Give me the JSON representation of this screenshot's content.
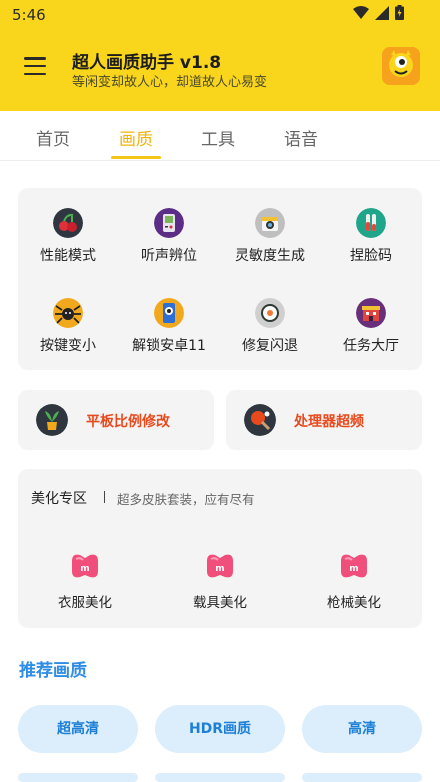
{
  "status": {
    "time": "5:46"
  },
  "header": {
    "title": "超人画质助手 v1.8",
    "subtitle": "等闲变却故人心，却道故人心易变",
    "accent_color": "#f9d51c"
  },
  "tabs": [
    {
      "label": "首页"
    },
    {
      "label": "画质"
    },
    {
      "label": "工具"
    },
    {
      "label": "语音"
    }
  ],
  "active_tab": "画质",
  "feature_grid": [
    {
      "label": "性能模式",
      "icon": "cherries-icon"
    },
    {
      "label": "听声辨位",
      "icon": "gameboy-icon"
    },
    {
      "label": "灵敏度生成",
      "icon": "camera-icon"
    },
    {
      "label": "捏脸码",
      "icon": "test-tube-icon"
    },
    {
      "label": "按键变小",
      "icon": "spider-icon"
    },
    {
      "label": "解锁安卓11",
      "icon": "phone-eye-icon"
    },
    {
      "label": "修复闪退",
      "icon": "sushi-icon"
    },
    {
      "label": "任务大厅",
      "icon": "building-icon"
    }
  ],
  "half_cards": [
    {
      "label": "平板比例修改",
      "icon": "plant-icon"
    },
    {
      "label": "处理器超频",
      "icon": "ping-pong-icon"
    }
  ],
  "beauty": {
    "title": "美化专区",
    "subtitle": "超多皮肤套装，应有尽有",
    "items": [
      {
        "label": "衣服美化"
      },
      {
        "label": "载具美化"
      },
      {
        "label": "枪械美化"
      }
    ]
  },
  "recommend": {
    "title": "推荐画质",
    "options": [
      {
        "label": "超高清"
      },
      {
        "label": "HDR画质"
      },
      {
        "label": "高清"
      }
    ]
  }
}
